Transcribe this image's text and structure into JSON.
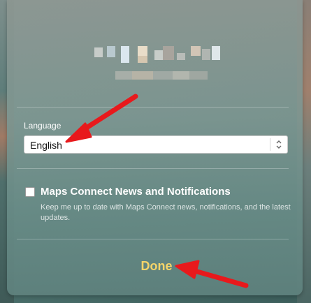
{
  "language_section": {
    "label": "Language",
    "selected_value": "English"
  },
  "newsletter": {
    "title": "Maps Connect News and Notifications",
    "description": "Keep me up to date with Maps Connect news, notifications, and the latest updates.",
    "checked": false
  },
  "actions": {
    "done_label": "Done"
  },
  "colors": {
    "done_text": "#f5d469",
    "annotation_arrow": "#e8191c"
  },
  "icons": {
    "select_stepper": "up-down-chevron-icon"
  }
}
